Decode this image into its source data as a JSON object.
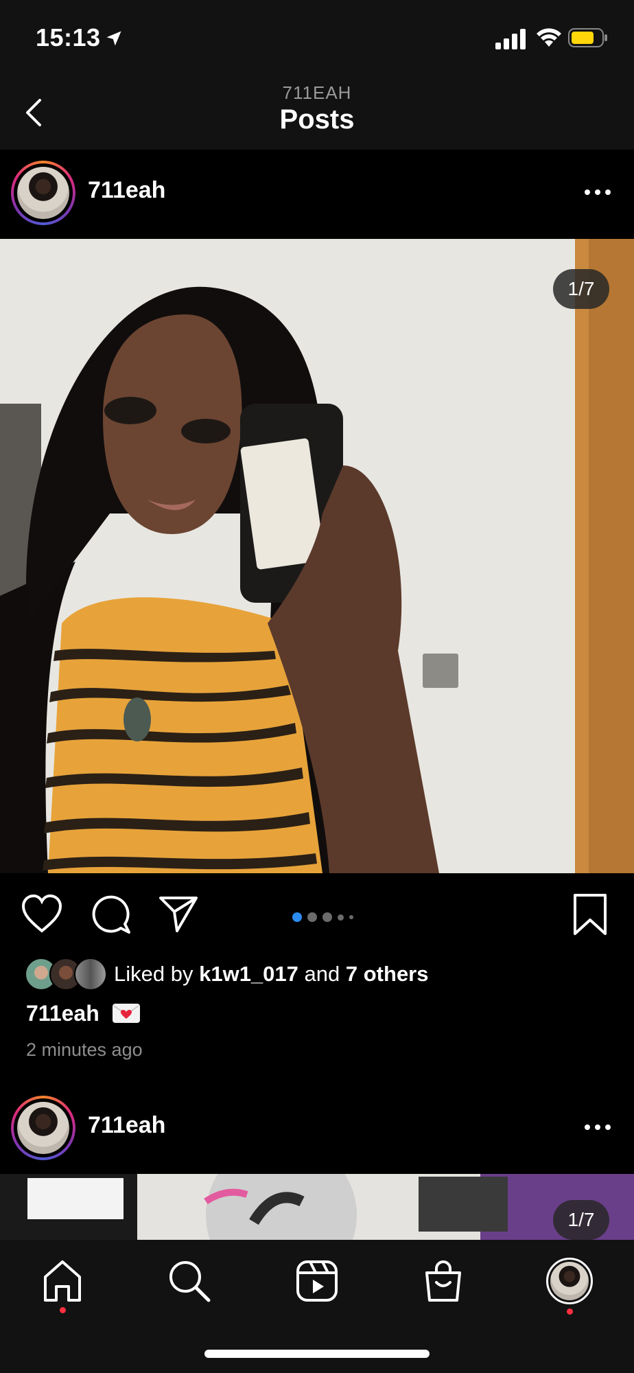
{
  "status_bar": {
    "time": "15:13"
  },
  "header": {
    "account": "711EAH",
    "title": "Posts"
  },
  "posts": [
    {
      "username": "711eah",
      "image_counter": "1/7",
      "carousel_dots": 5,
      "active_dot": 0,
      "likes": {
        "prefix": "Liked by",
        "user": "k1w1_017",
        "joiner": "and",
        "others": "7 others"
      },
      "caption_user": "711eah",
      "caption_emoji": "love-letter",
      "time_ago": "2 minutes ago"
    },
    {
      "username": "711eah",
      "image_counter": "1/7"
    }
  ],
  "tab_bar": {
    "items": [
      "home-icon",
      "search-icon",
      "reels-icon",
      "shop-icon",
      "profile-avatar"
    ],
    "active": "home-icon"
  },
  "colors": {
    "accent_blue": "#2a8cf0",
    "notification": "#ff3040",
    "battery": "#ffd60a"
  }
}
